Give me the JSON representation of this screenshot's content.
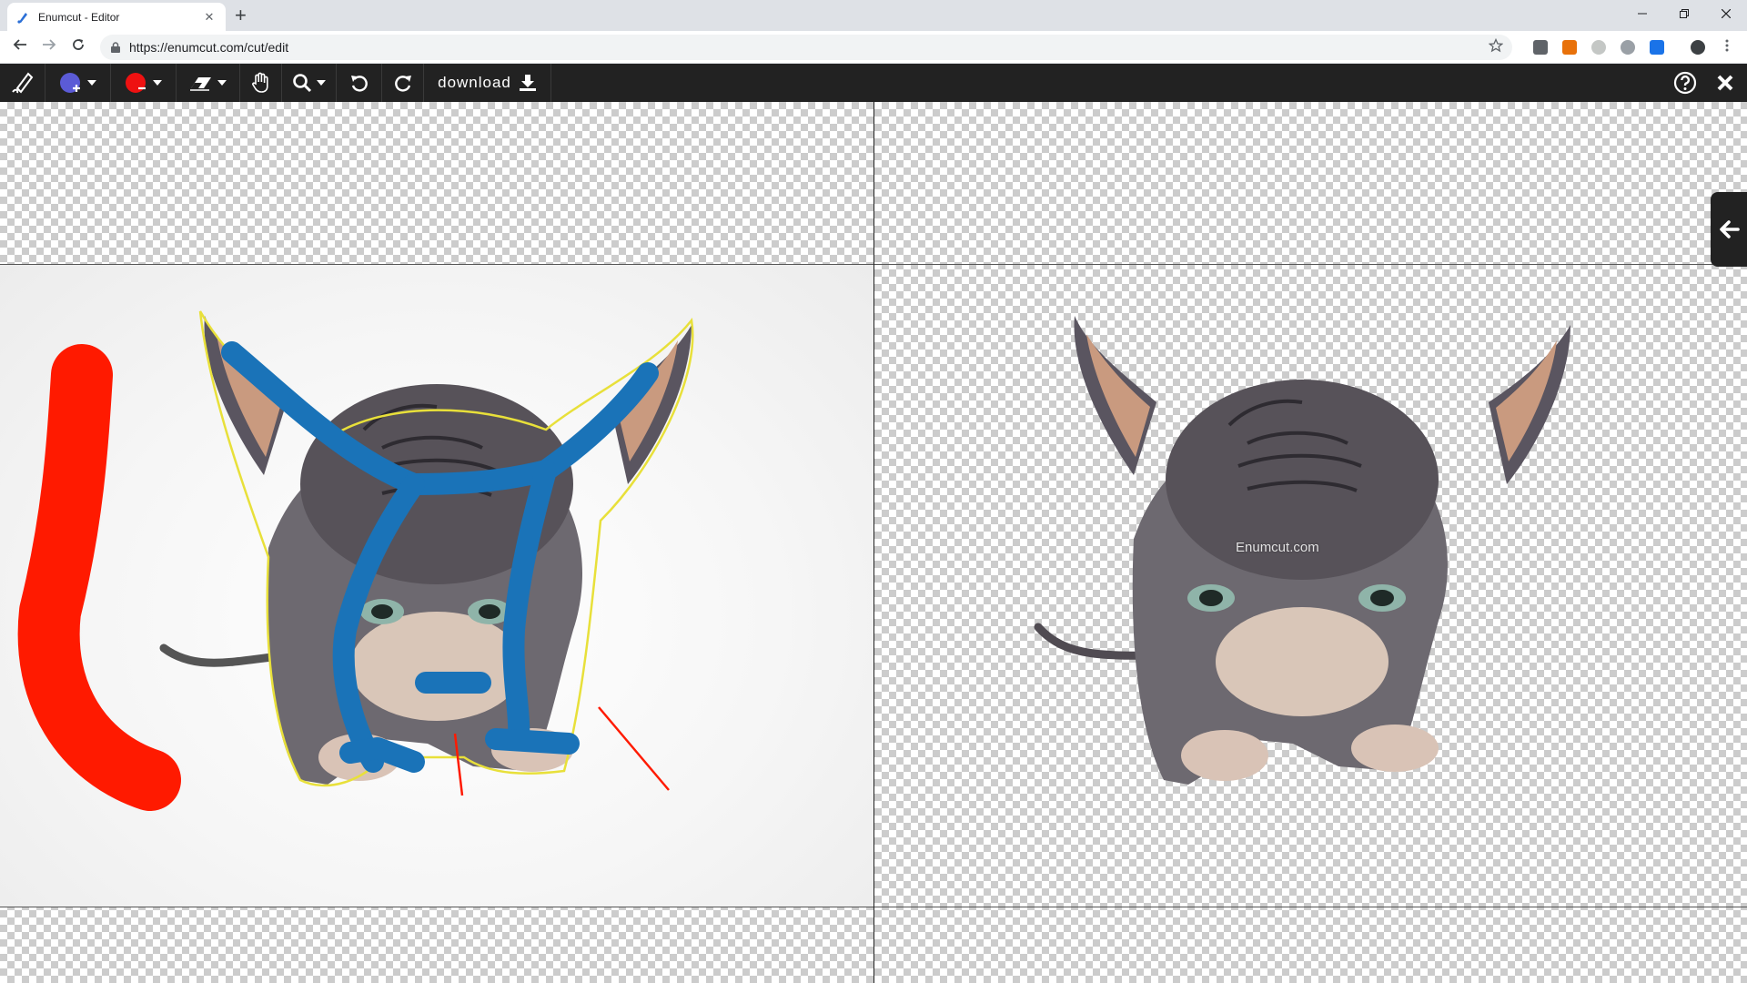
{
  "browser": {
    "tab_title": "Enumcut - Editor",
    "url": "https://enumcut.com/cut/edit",
    "new_tab_symbol": "+",
    "tab_close_symbol": "✕"
  },
  "toolbar": {
    "logo_icon": "pen-logo-icon",
    "keep_brush_color": "#5b5bd6",
    "remove_brush_color": "#ee1111",
    "tools": [
      "keep-brush",
      "remove-brush",
      "eraser",
      "hand-pan",
      "zoom",
      "undo",
      "redo"
    ],
    "download_label": "download",
    "help_icon": "help-icon",
    "close_icon": "close-icon"
  },
  "canvas": {
    "watermark": "Enumcut.com",
    "keep_stroke_color": "#1a73b8",
    "remove_stroke_color": "#ff1a00",
    "outline_color": "#e8e03a",
    "side_panel_icon": "arrow-left-icon"
  }
}
